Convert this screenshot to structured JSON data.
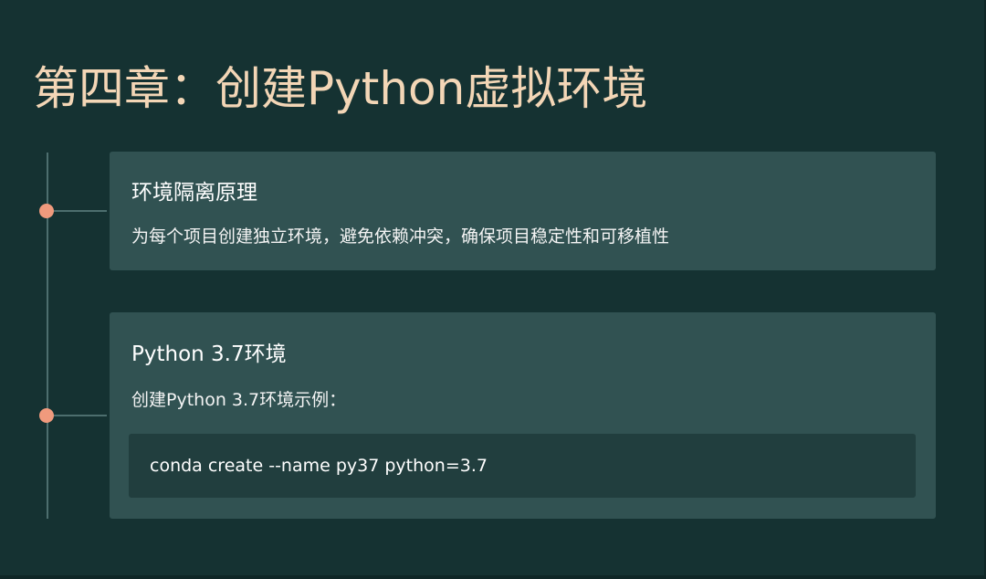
{
  "slide": {
    "title": "第四章：创建Python虚拟环境"
  },
  "timeline": {
    "items": [
      {
        "title": "环境隔离原理",
        "description": "为每个项目创建独立环境，避免依赖冲突，确保项目稳定性和可移植性"
      },
      {
        "title": "Python 3.7环境",
        "description": "创建Python 3.7环境示例：",
        "code": "conda create --name py37 python=3.7"
      }
    ]
  },
  "colors": {
    "background": "#153232",
    "card": "#315252",
    "code_background": "#213e3e",
    "title": "#f3d6b6",
    "node": "#f09a7d",
    "line": "#4d6e6e"
  }
}
